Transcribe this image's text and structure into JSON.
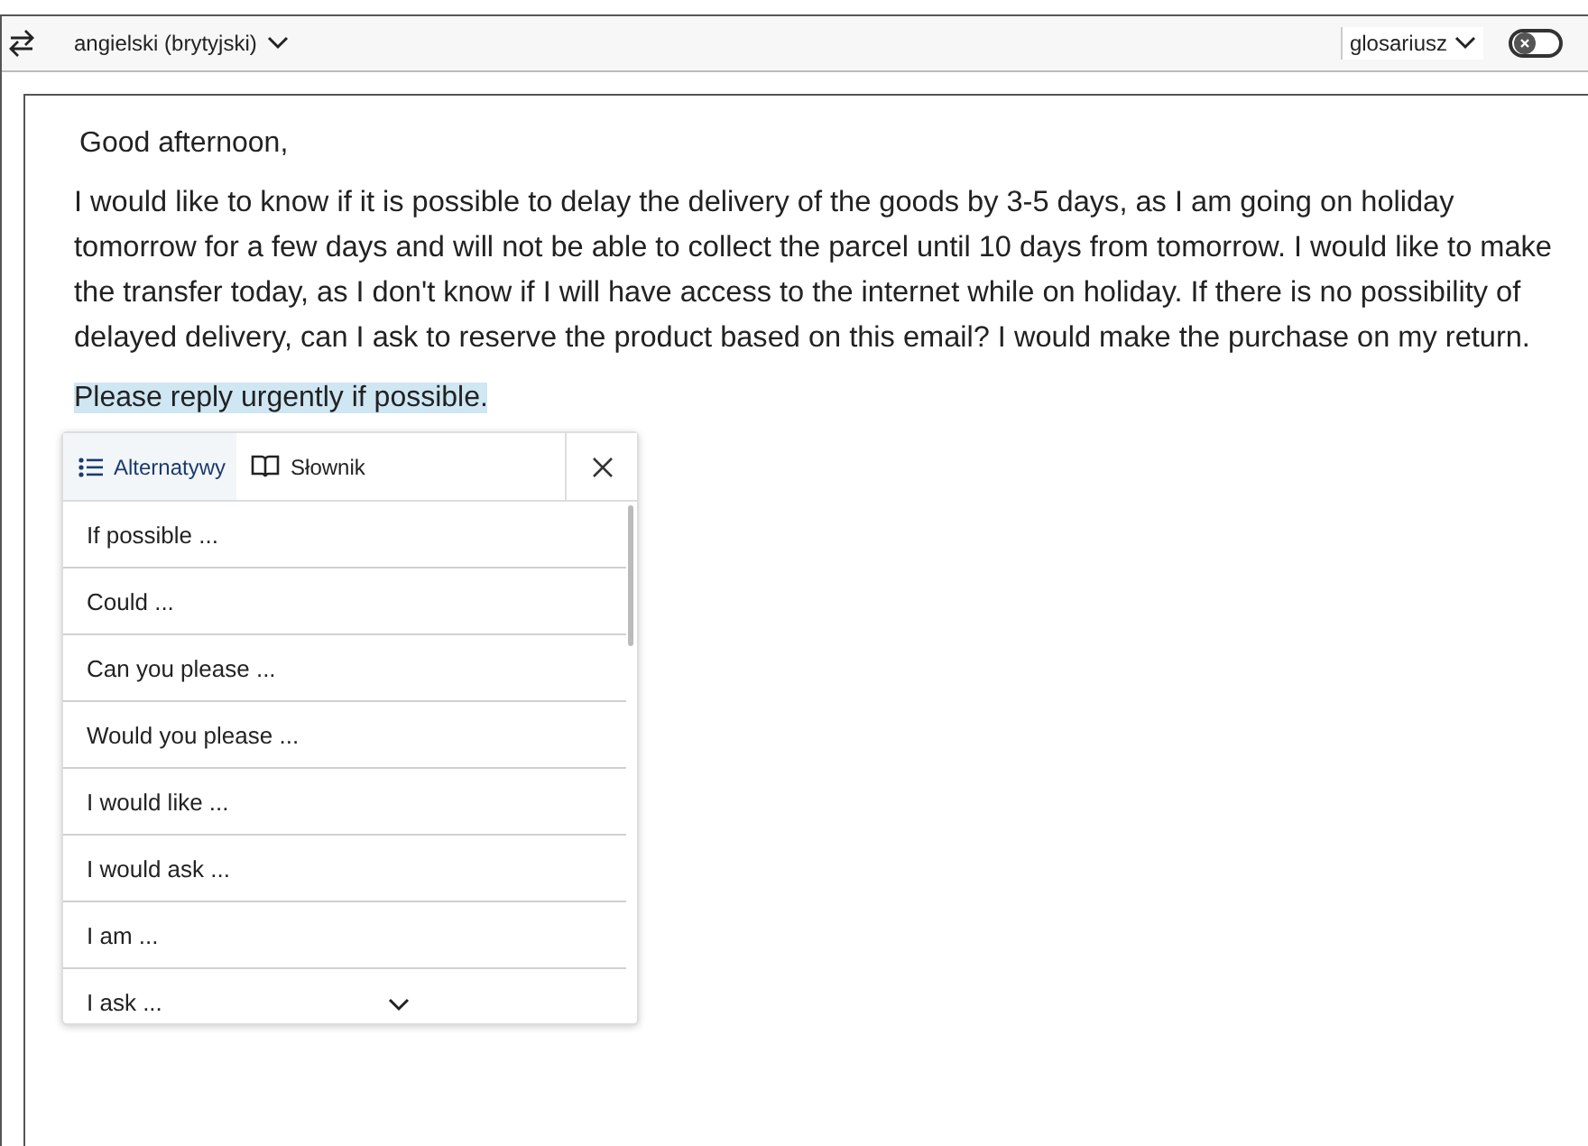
{
  "toolbar": {
    "language": "angielski (brytyjski)",
    "glossary": "glosariusz",
    "glossary_toggle": {
      "on": false
    }
  },
  "document": {
    "greeting": "Good afternoon,",
    "paragraph": "I would like to know if it is possible to delay the delivery of the goods by 3-5 days, as I am going on holiday tomorrow for a few days and will not be able to collect the parcel until 10 days from tomorrow. I would like to make the transfer today, as I don't know if I will have access to the internet while on holiday. If there is no possibility of delayed delivery, can I ask to reserve the product based on this email? I would make the purchase on my return.",
    "highlighted_sentence": "Please reply urgently if possible."
  },
  "popup": {
    "tabs": [
      {
        "label": "Alternatywy",
        "kind": "list",
        "selected": true
      },
      {
        "label": "Słownik",
        "kind": "book",
        "selected": false
      }
    ],
    "items": [
      "If possible ...",
      "Could ...",
      "Can you please ...",
      "Would you please ...",
      "I would like ...",
      "I would ask ...",
      "I am ...",
      "I ask ..."
    ]
  }
}
